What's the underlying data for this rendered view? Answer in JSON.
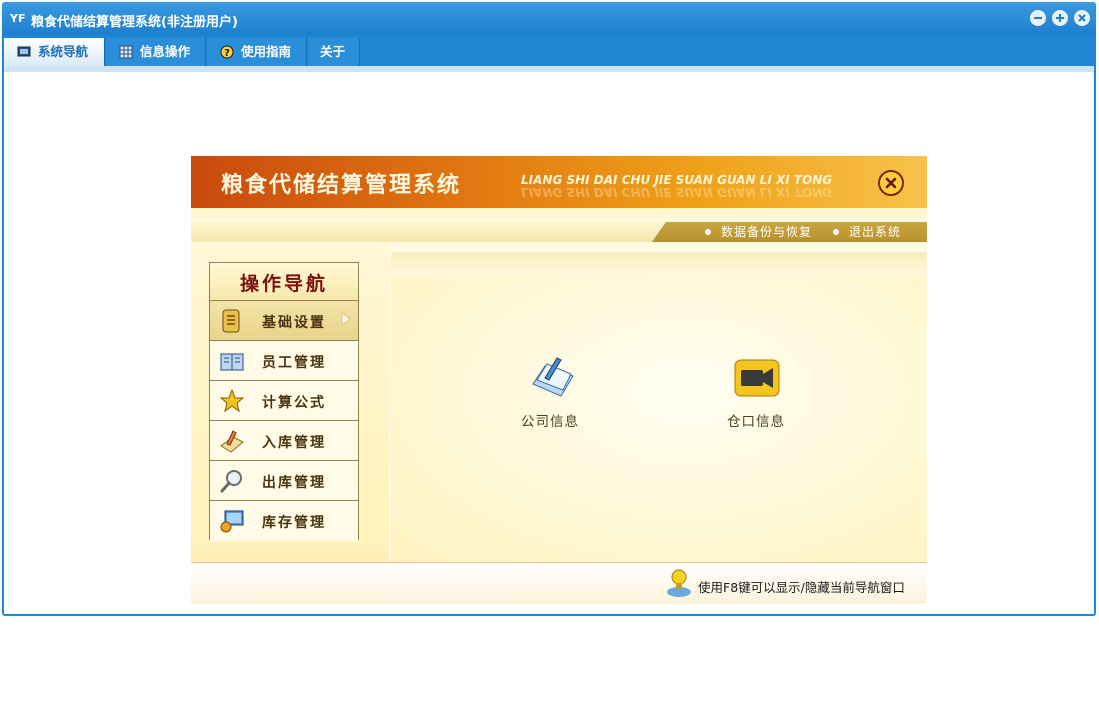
{
  "window": {
    "title": "粮食代储结算管理系统(非注册用户)",
    "app_icon": "yf-app-icon"
  },
  "menu": {
    "items": [
      {
        "label": "系统导航",
        "icon": "monitor-icon",
        "active": true
      },
      {
        "label": "信息操作",
        "icon": "grid-icon",
        "active": false
      },
      {
        "label": "使用指南",
        "icon": "help-icon",
        "active": false
      },
      {
        "label": "关于",
        "icon": "",
        "active": false
      }
    ]
  },
  "banner": {
    "title": "粮食代储结算管理系统",
    "subtitle": "LIANG SHI DAI CHU JIE SUAN GUAN LI XI TONG"
  },
  "toolbar": {
    "backup_label": "数据备份与恢复",
    "exit_label": "退出系统"
  },
  "nav": {
    "header": "操作导航",
    "items": [
      {
        "label": "基础设置",
        "icon": "notepad-icon",
        "selected": true
      },
      {
        "label": "员工管理",
        "icon": "book-icon",
        "selected": false
      },
      {
        "label": "计算公式",
        "icon": "star-icon",
        "selected": false
      },
      {
        "label": "入库管理",
        "icon": "inbound-icon",
        "selected": false
      },
      {
        "label": "出库管理",
        "icon": "magnifier-icon",
        "selected": false
      },
      {
        "label": "库存管理",
        "icon": "computer-icon",
        "selected": false
      }
    ]
  },
  "content": {
    "tiles": [
      {
        "label": "公司信息",
        "icon": "document-edit-icon"
      },
      {
        "label": "仓口信息",
        "icon": "video-camera-icon"
      }
    ]
  },
  "footer": {
    "hint": "使用F8键可以显示/隐藏当前导航窗口"
  },
  "colors": {
    "window_blue": "#1f86d4",
    "banner_orange": "#e07410",
    "nav_header_text": "#7a1010"
  }
}
